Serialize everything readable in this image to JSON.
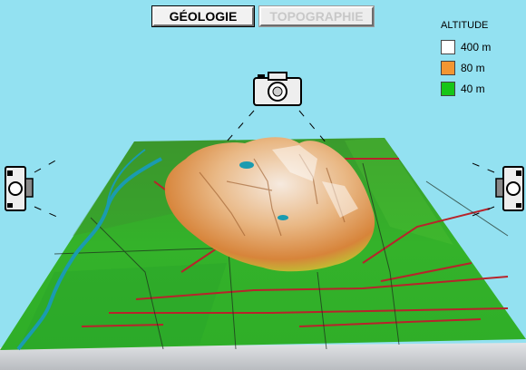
{
  "tabs": [
    {
      "label": "GÉOLOGIE",
      "state": "active"
    },
    {
      "label": "TOPOGRAPHIE",
      "state": "disabled"
    }
  ],
  "legend": {
    "title": "ALTITUDE",
    "items": [
      {
        "label": "400 m",
        "color": "#ffffff"
      },
      {
        "label": "80 m",
        "color": "#f39632"
      },
      {
        "label": "40 m",
        "color": "#17c617"
      }
    ]
  },
  "cameras": [
    {
      "name": "camera-top",
      "icon": "camera-icon"
    },
    {
      "name": "camera-left",
      "icon": "camera-icon"
    },
    {
      "name": "camera-right",
      "icon": "camera-icon"
    }
  ],
  "colors": {
    "sky": "#93e1f1",
    "plain_green": "#2fae28",
    "mountain_orange": "#d98a3f",
    "mountain_light": "#f3dcc4",
    "river": "#1a9bb0",
    "roads": "#b8232b",
    "base": "#cfd2d6"
  }
}
